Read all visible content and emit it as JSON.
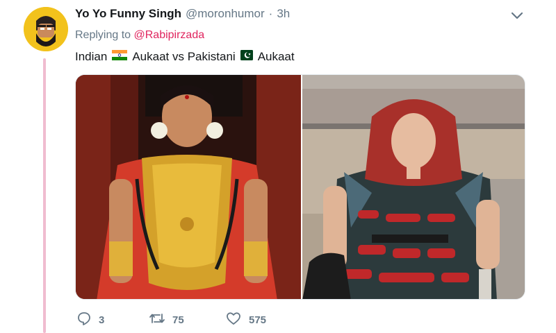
{
  "tweet": {
    "display_name": "Yo Yo Funny Singh",
    "handle": "@moronhumor",
    "separator": "·",
    "time": "3h",
    "replying_prefix": "Replying to",
    "replying_to": "@Rabipirzada",
    "text_part1": "Indian",
    "text_part2": "Aukaat vs Pakistani",
    "text_part3": "Aukaat",
    "flag_1": "india-flag-icon",
    "flag_2": "pakistan-flag-icon"
  },
  "actions": {
    "reply_count": "3",
    "retweet_count": "75",
    "like_count": "575"
  },
  "colors": {
    "text_primary": "#14171a",
    "text_secondary": "#657786",
    "mention": "#e0245e",
    "thread_line": "#f0bcd0",
    "avatar_bg": "#f2c21c"
  }
}
